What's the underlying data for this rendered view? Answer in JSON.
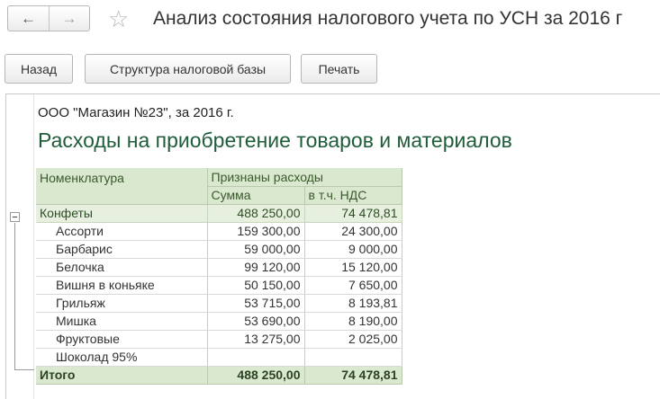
{
  "window": {
    "title": "Анализ состояния налогового учета по УСН за 2016 г",
    "back_icon": "←",
    "forward_icon": "→",
    "star_icon": "☆"
  },
  "toolbar": {
    "back_label": "Назад",
    "structure_label": "Структура налоговой базы",
    "print_label": "Печать"
  },
  "report": {
    "org_line": "ООО \"Магазин №23\",  за 2016 г.",
    "heading": "Расходы на приобретение товаров и материалов",
    "columns": {
      "nomenclature": "Номенклатура",
      "recognized": "Признаны расходы",
      "sum": "Сумма",
      "vat": "в т.ч. НДС"
    },
    "group": {
      "name": "Конфеты",
      "sum": "488 250,00",
      "vat": "74 478,81"
    },
    "rows": [
      {
        "name": "Ассорти",
        "sum": "159 300,00",
        "vat": "24 300,00"
      },
      {
        "name": "Барбарис",
        "sum": "59 000,00",
        "vat": "9 000,00"
      },
      {
        "name": "Белочка",
        "sum": "99 120,00",
        "vat": "15 120,00"
      },
      {
        "name": "Вишня в коньяке",
        "sum": "50 150,00",
        "vat": "7 650,00"
      },
      {
        "name": "Грильяж",
        "sum": "53 715,00",
        "vat": "8 193,81"
      },
      {
        "name": "Мишка",
        "sum": "53 690,00",
        "vat": "8 190,00"
      },
      {
        "name": "Фруктовые",
        "sum": "13 275,00",
        "vat": "2 025,00"
      },
      {
        "name": "Шоколад 95%",
        "sum": "",
        "vat": ""
      }
    ],
    "total": {
      "label": "Итого",
      "sum": "488 250,00",
      "vat": "74 478,81"
    }
  }
}
